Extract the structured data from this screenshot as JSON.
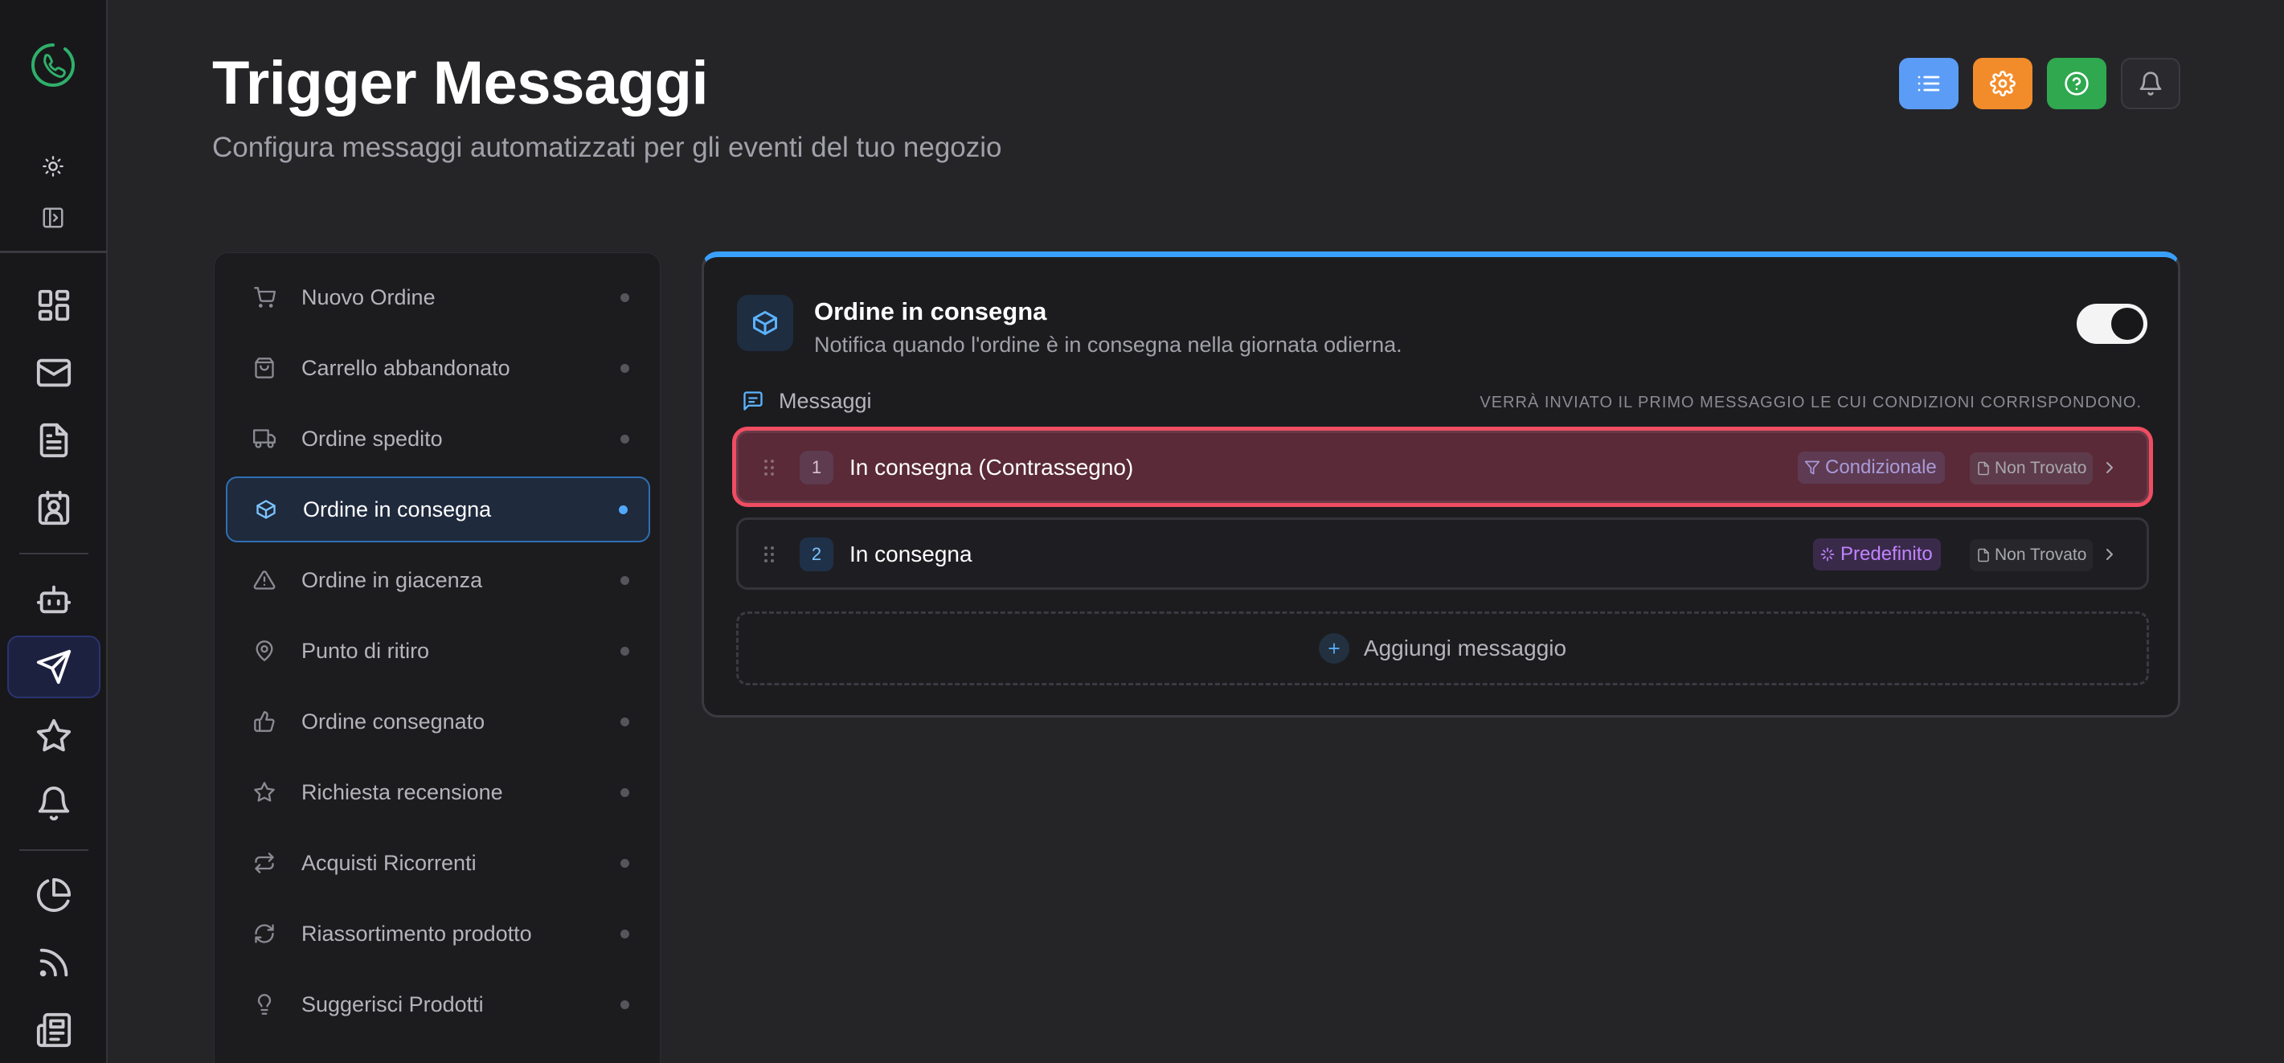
{
  "header": {
    "title": "Trigger Messaggi",
    "subtitle": "Configura messaggi automatizzati per gli eventi del tuo negozio",
    "buttons": [
      {
        "name": "list-button",
        "icon": "list-icon",
        "color": "#5b9cf6"
      },
      {
        "name": "settings-button",
        "icon": "gear-icon",
        "color": "#f28c2a"
      },
      {
        "name": "help-button",
        "icon": "help-icon",
        "color": "#2fa84f"
      },
      {
        "name": "notifications-button",
        "icon": "bell-icon",
        "color": "#2a2a2e"
      }
    ]
  },
  "rail": {
    "items": [
      "theme-toggle-icon",
      "sidebar-toggle-icon",
      "dashboard-icon",
      "mail-icon",
      "document-icon",
      "contacts-icon",
      "bot-icon",
      "send-icon",
      "star-icon",
      "bell-icon",
      "pie-chart-icon",
      "rss-icon",
      "news-icon"
    ],
    "active": "send-icon"
  },
  "triggers": [
    {
      "label": "Nuovo Ordine",
      "icon": "cart-icon"
    },
    {
      "label": "Carrello abbandonato",
      "icon": "bag-icon"
    },
    {
      "label": "Ordine spedito",
      "icon": "truck-icon"
    },
    {
      "label": "Ordine in consegna",
      "icon": "package-icon",
      "active": true
    },
    {
      "label": "Ordine in giacenza",
      "icon": "warning-icon"
    },
    {
      "label": "Punto di ritiro",
      "icon": "map-pin-icon"
    },
    {
      "label": "Ordine consegnato",
      "icon": "thumbs-up-icon"
    },
    {
      "label": "Richiesta recensione",
      "icon": "star-icon"
    },
    {
      "label": "Acquisti Ricorrenti",
      "icon": "repeat-icon"
    },
    {
      "label": "Riassortimento prodotto",
      "icon": "refresh-icon"
    },
    {
      "label": "Suggerisci Prodotti",
      "icon": "lightbulb-icon"
    }
  ],
  "detail": {
    "title": "Ordine in consegna",
    "description": "Notifica quando l'ordine è in consegna nella giornata odierna.",
    "enabled": true,
    "messages_label": "Messaggi",
    "messages_note": "Verrà inviato il primo messaggio le cui condizioni corrispondono.",
    "messages": [
      {
        "number": "1",
        "label": "In consegna (Contrassegno)",
        "badge": "Condizionale",
        "badge_icon": "filter-icon",
        "badge_color": "#a99ad9",
        "status": "Non Trovato",
        "selected": true
      },
      {
        "number": "2",
        "label": "In consegna",
        "badge": "Predefinito",
        "badge_icon": "sparkle-icon",
        "badge_color": "#c184ff",
        "status": "Non Trovato",
        "selected": false
      }
    ],
    "add_label": "Aggiungi messaggio"
  },
  "colors": {
    "accent": "#3aa0ff",
    "selection": "#ef4d62",
    "background": "#252528"
  }
}
